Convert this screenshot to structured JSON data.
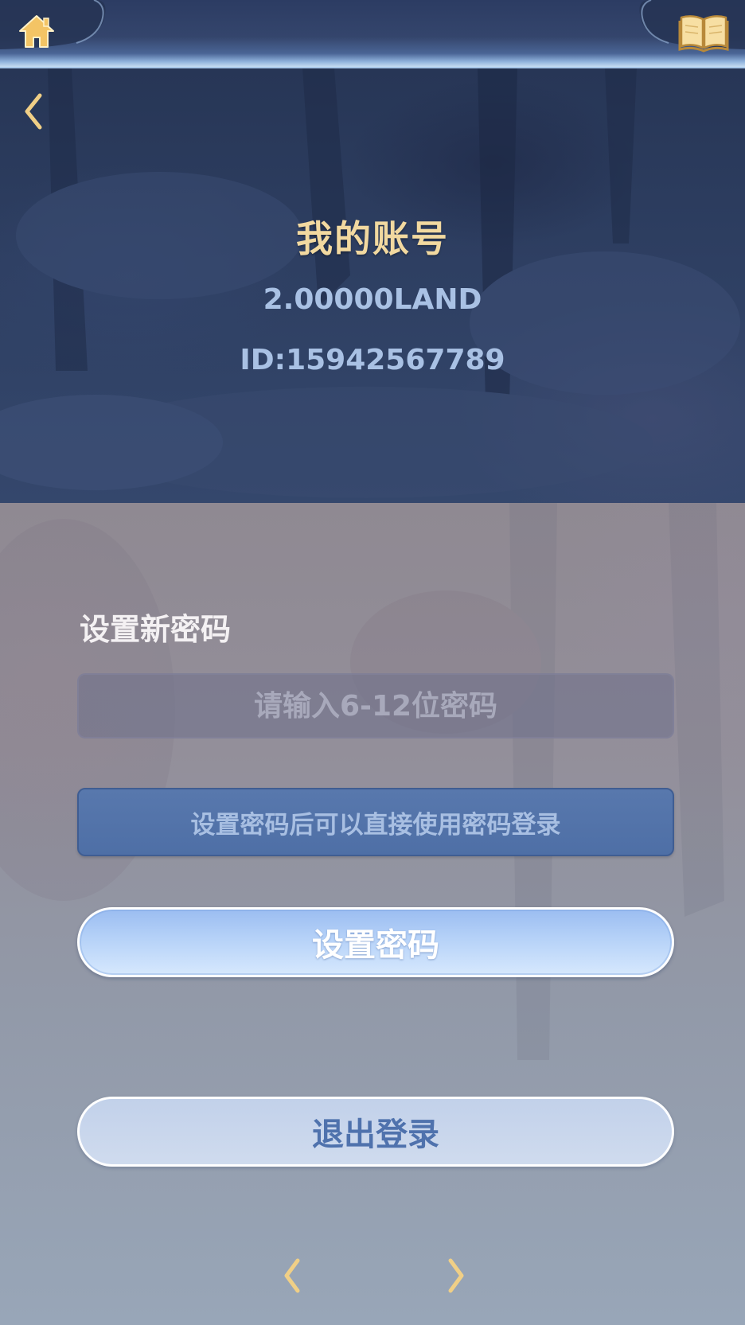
{
  "topbar": {
    "home_icon": "home-icon",
    "book_icon": "book-icon"
  },
  "header": {
    "back_icon": "chevron-left-icon",
    "title": "我的账号",
    "balance": "2.00000LAND",
    "account_id": "ID:15942567789"
  },
  "form": {
    "section_label": "设置新密码",
    "password": {
      "value": "",
      "placeholder": "请输入6-12位密码"
    },
    "hint": "设置密码后可以直接使用密码登录",
    "set_password_label": "设置密码",
    "logout_label": "退出登录"
  },
  "pager": {
    "prev_icon": "chevron-left-icon",
    "next_icon": "chevron-right-icon"
  },
  "colors": {
    "gold_accent": "#f2d9a0",
    "header_bg": "#2e3f62",
    "hint_bg": "#5878ad",
    "button_blue": "#b6d2f8",
    "logout_text": "#4f72ad"
  }
}
